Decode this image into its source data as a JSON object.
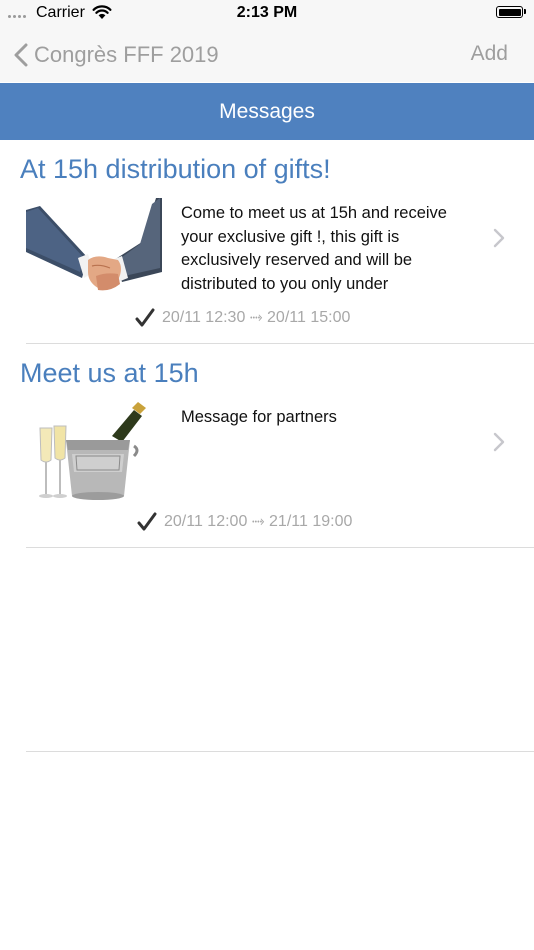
{
  "status_bar": {
    "carrier": "Carrier",
    "time": "2:13 PM",
    "battery_level": 1.0
  },
  "nav": {
    "back_label": "Congrès FFF 2019",
    "add_label": "Add"
  },
  "header": {
    "title": "Messages",
    "background": "#4f81bf"
  },
  "messages": [
    {
      "title": "At 15h distribution of gifts!",
      "body": "Come to meet us at 15h and receive your exclusive gift !, this gift is exclusively reserved and will be distributed to you only under",
      "date_range": "20/11 12:30 ⤑ 20/11 15:00",
      "image_icon": "handshake-image",
      "checked": true
    },
    {
      "title": "Meet us at 15h",
      "body": "Message for partners",
      "date_range": "20/11 12:00 ⤑ 21/11 19:00",
      "image_icon": "champagne-bucket-image",
      "checked": true
    }
  ],
  "colors": {
    "accent": "#4a7fbd",
    "nav_text": "#9e9e9e",
    "meta_text": "#a8a8a8"
  }
}
